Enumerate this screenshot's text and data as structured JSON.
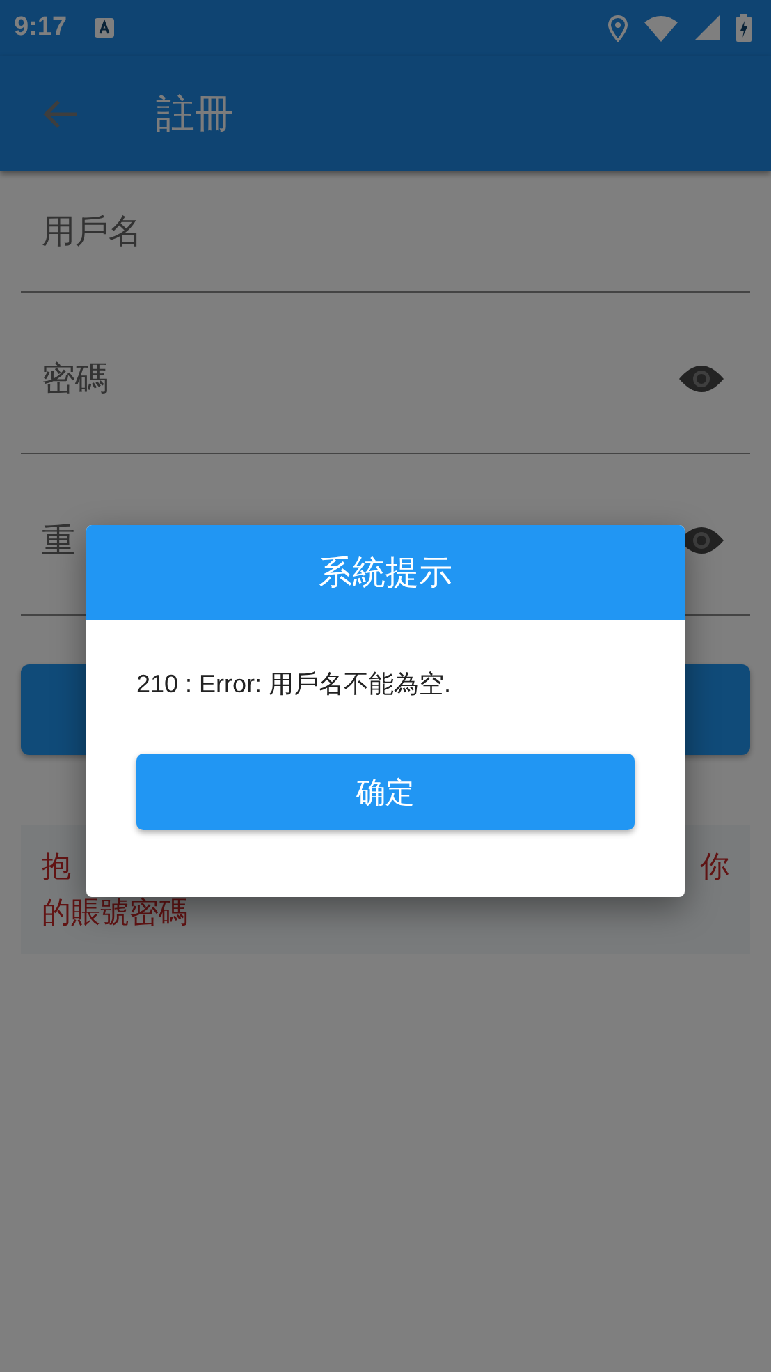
{
  "status_bar": {
    "time": "9:17"
  },
  "app_bar": {
    "title": "註冊"
  },
  "fields": [
    {
      "label": "用戶名",
      "password_toggle": false
    },
    {
      "label": "密碼",
      "password_toggle": true
    },
    {
      "label": "重",
      "password_toggle": true
    }
  ],
  "notice": {
    "line_1_start": "抱",
    "line_1_end": "你",
    "line_2": "的賬號密碼"
  },
  "dialog": {
    "title": "系統提示",
    "message": "210 : Error: 用戶名不能為空.",
    "button": "确定"
  }
}
